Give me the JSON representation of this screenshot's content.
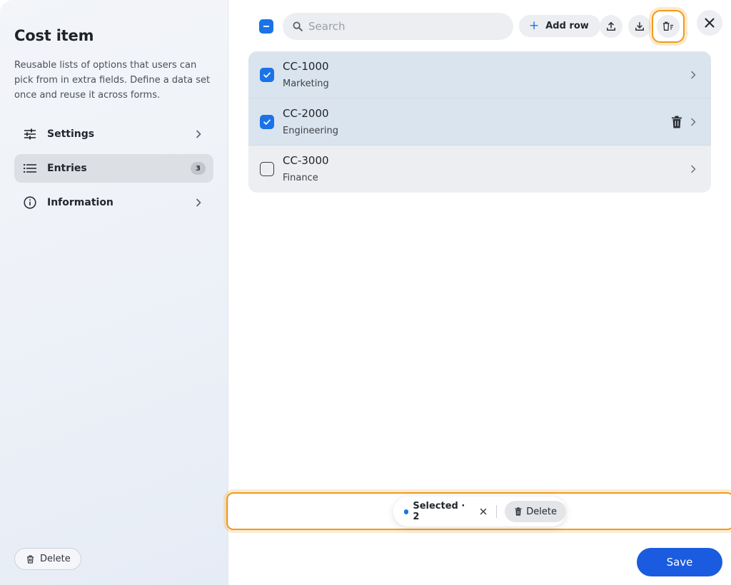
{
  "sidebar": {
    "title": "Cost item",
    "description": "Reusable lists of options that users can pick from in extra fields. Define a data set once and reuse it across forms.",
    "items": [
      {
        "label": "Settings",
        "icon": "sliders-icon"
      },
      {
        "label": "Entries",
        "icon": "list-icon",
        "badge": "3",
        "active": true
      },
      {
        "label": "Information",
        "icon": "info-icon"
      }
    ],
    "delete_label": "Delete"
  },
  "toolbar": {
    "search_placeholder": "Search",
    "add_row_label": "Add row"
  },
  "entries": [
    {
      "code": "CC-1000",
      "name": "Marketing",
      "checked": true
    },
    {
      "code": "CC-2000",
      "name": "Engineering",
      "checked": true
    },
    {
      "code": "CC-3000",
      "name": "Finance",
      "checked": false
    }
  ],
  "selection_bar": {
    "selected_label": "Selected · 2",
    "delete_label": "Delete"
  },
  "footer": {
    "save_label": "Save"
  },
  "colors": {
    "accent": "#1a73e8",
    "save": "#1a5be0",
    "highlight": "#f09a1a"
  }
}
